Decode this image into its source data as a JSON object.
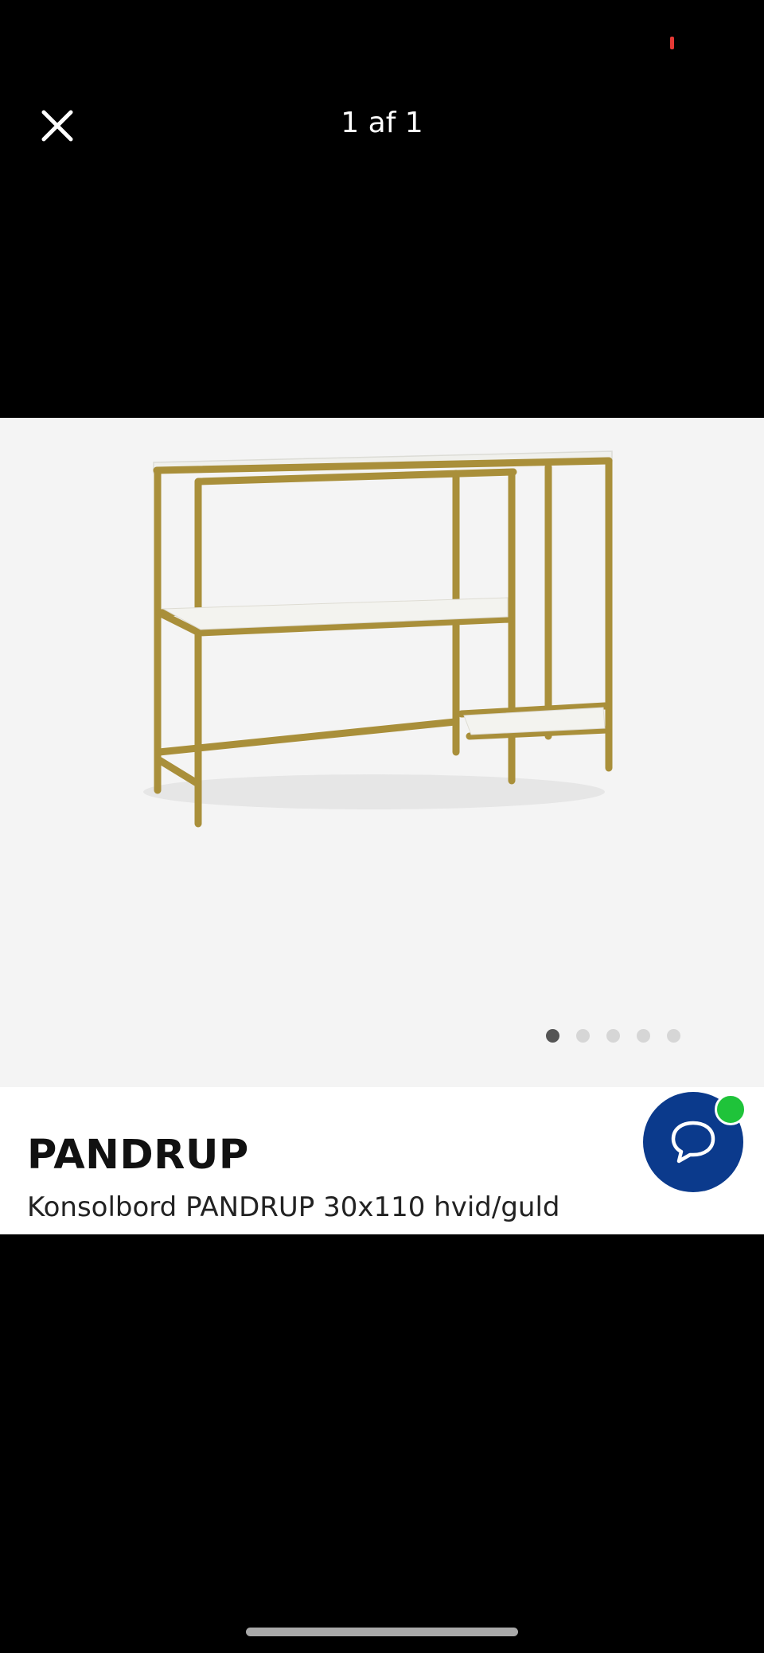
{
  "viewer": {
    "counter": "1 af 1",
    "close_icon": "close-icon"
  },
  "carousel": {
    "image_subject": "console-table-illustration",
    "total_slides": 5,
    "active_slide": 1
  },
  "product": {
    "brand": "PANDRUP",
    "title": "Konsolbord PANDRUP 30x110 hvid/guld"
  },
  "chat": {
    "icon": "chat-bubble-icon",
    "status": "online",
    "status_color": "#1fc33a",
    "button_color": "#0b3a8c"
  },
  "colors": {
    "background": "#000000",
    "frame_gold": "#a98f3a",
    "shelf": "#f1f1ee"
  }
}
